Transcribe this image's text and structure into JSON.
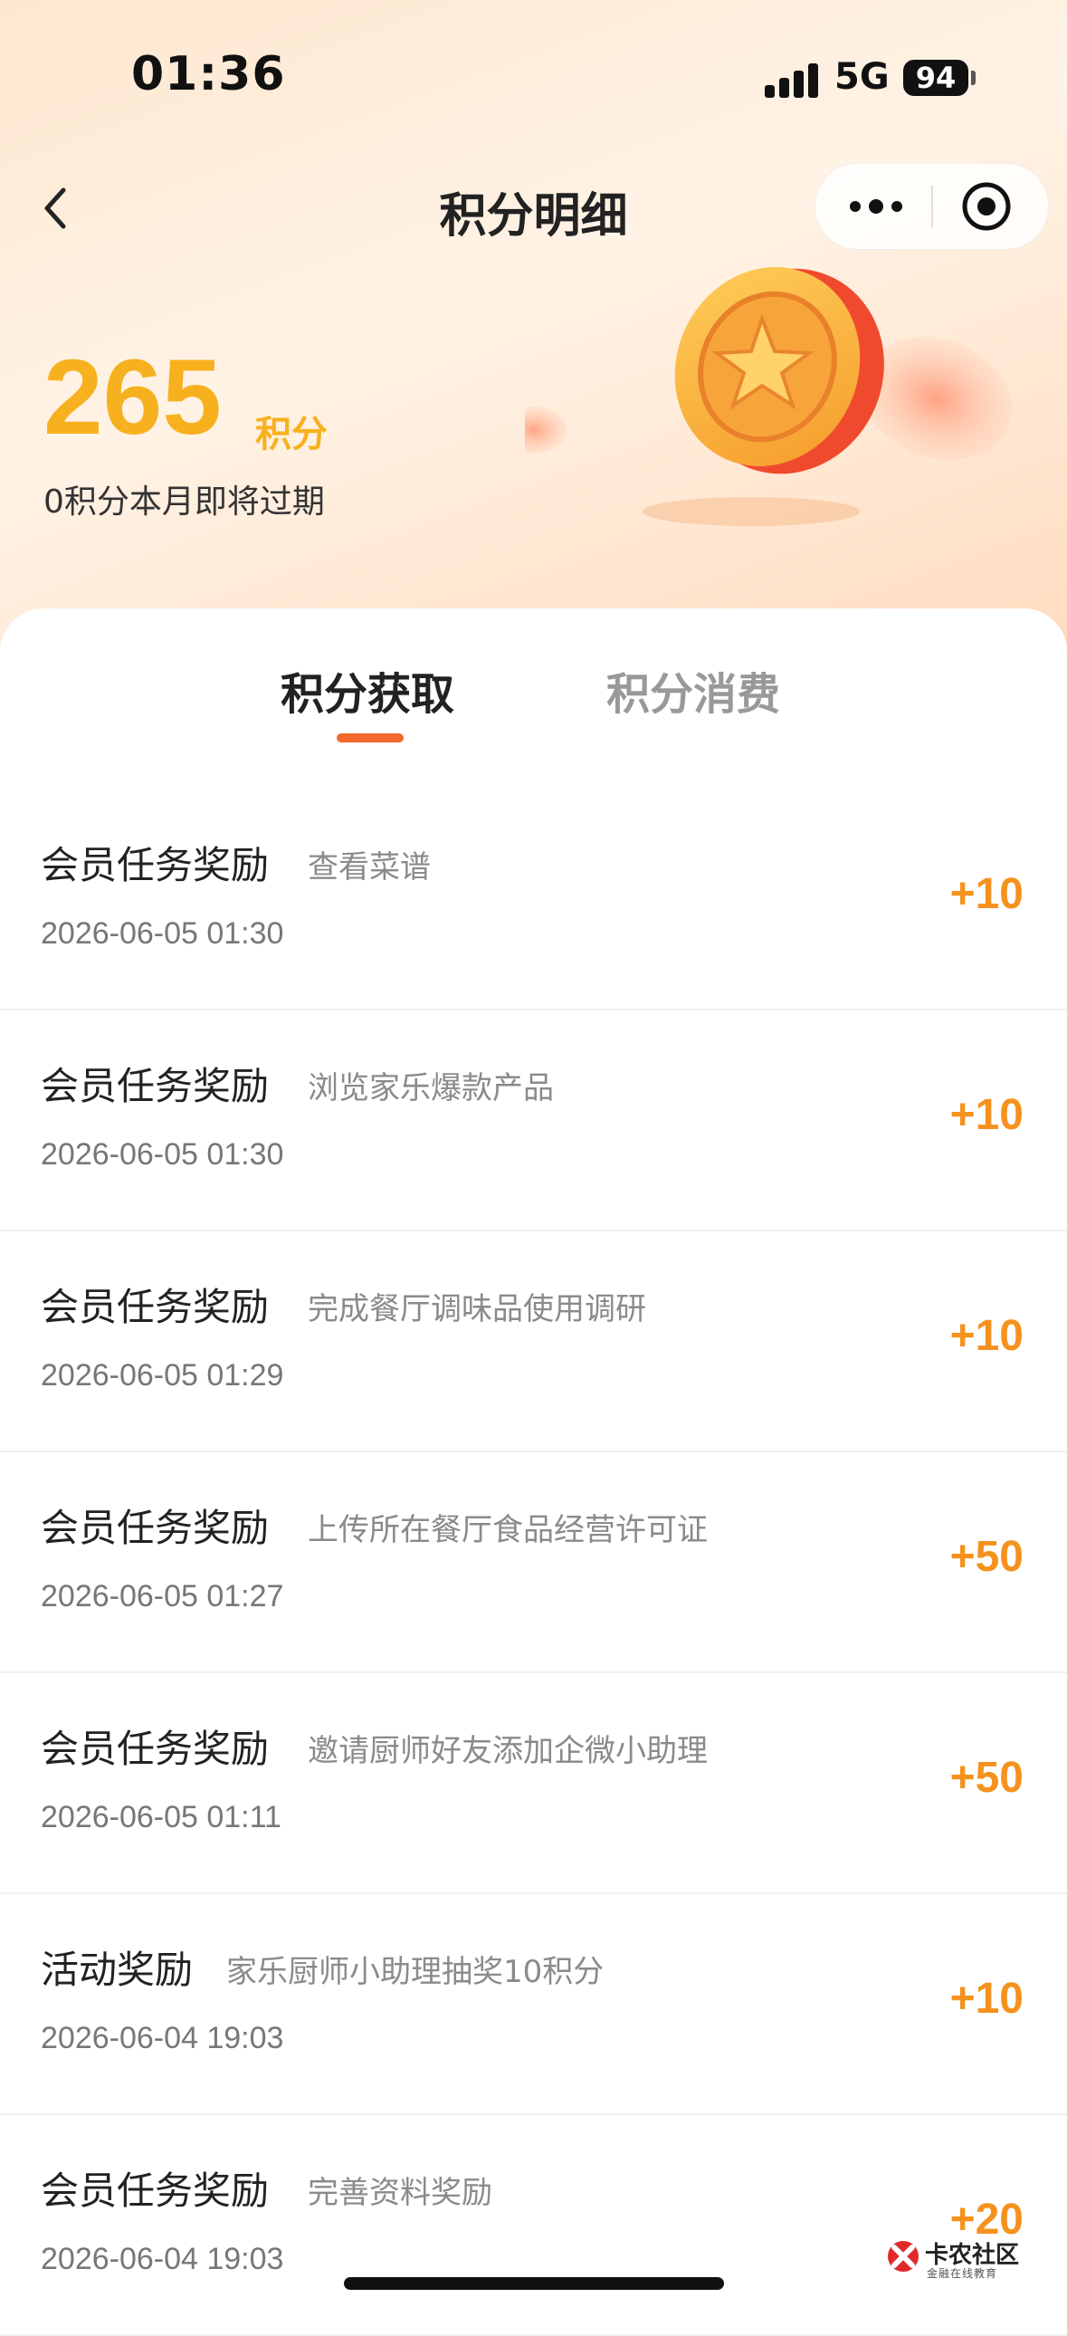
{
  "status_bar": {
    "time": "01:36",
    "network": "5G",
    "battery": "94"
  },
  "nav": {
    "title": "积分明细"
  },
  "summary": {
    "points": "265",
    "unit": "积分",
    "expire_note": "0积分本月即将过期"
  },
  "tabs": [
    {
      "label": "积分获取",
      "active": true
    },
    {
      "label": "积分消费",
      "active": false
    }
  ],
  "records": [
    {
      "title": "会员任务奖励",
      "desc": "查看菜谱",
      "date": "2026-06-05 01:30",
      "amount": "+10"
    },
    {
      "title": "会员任务奖励",
      "desc": "浏览家乐爆款产品",
      "date": "2026-06-05 01:30",
      "amount": "+10"
    },
    {
      "title": "会员任务奖励",
      "desc": "完成餐厅调味品使用调研",
      "date": "2026-06-05 01:29",
      "amount": "+10"
    },
    {
      "title": "会员任务奖励",
      "desc": "上传所在餐厅食品经营许可证",
      "date": "2026-06-05 01:27",
      "amount": "+50"
    },
    {
      "title": "会员任务奖励",
      "desc": "邀请厨师好友添加企微小助理",
      "date": "2026-06-05 01:11",
      "amount": "+50"
    },
    {
      "title": "活动奖励",
      "desc": "家乐厨师小助理抽奖10积分",
      "date": "2026-06-04 19:03",
      "amount": "+10"
    },
    {
      "title": "会员任务奖励",
      "desc": "完善资料奖励",
      "date": "2026-06-04 19:03",
      "amount": "+20"
    }
  ],
  "watermark": {
    "main": "卡农社区",
    "sub": "金融在线教育"
  },
  "colors": {
    "accent": "#f5921e",
    "points": "#f7b11e",
    "tab_indicator": "#f26a2e"
  }
}
